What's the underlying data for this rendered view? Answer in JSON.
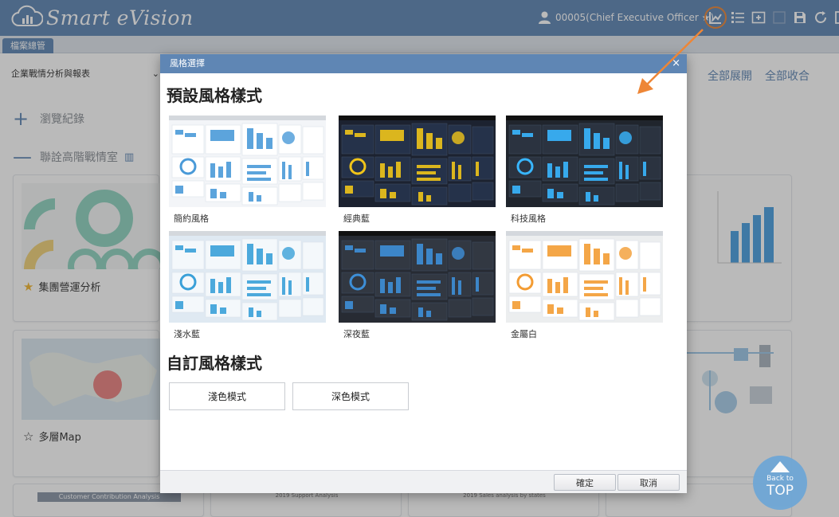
{
  "app": {
    "logo_text": "Smart eVision",
    "user_label": "00005(Chief Executive Officer ★)"
  },
  "toolbar_icons": [
    "style-chart-icon",
    "list-icon",
    "add-folder-icon",
    "blank-icon",
    "save-icon",
    "refresh-icon",
    "logout-icon"
  ],
  "tabs": [
    {
      "label": "檔案總管"
    }
  ],
  "background": {
    "select_value": "企業戰情分析與報表",
    "expand_all": "全部展開",
    "collapse_all": "全部收合",
    "section_history": "瀏覽紀錄",
    "section_room": "聯詮高階戰情室",
    "cards": [
      {
        "title": "集團營運分析",
        "starred": true
      },
      {
        "title": "多層Map",
        "starred": false
      }
    ],
    "bottom_thumb_titles": [
      "Customer Contribution Analysis",
      "2019 Support Analysis",
      "2019 Sales analysis by states"
    ]
  },
  "dialog": {
    "title": "風格選擇",
    "close_label": "×",
    "preset_section": "預設風格樣式",
    "presets": [
      {
        "label": "簡約風格",
        "bg": "#f3f5f8",
        "panel": "#ffffff",
        "accent": "#4a9ad8",
        "dark": false
      },
      {
        "label": "經典藍",
        "bg": "#1c2230",
        "panel": "#25324a",
        "accent": "#f0c419",
        "dark": true
      },
      {
        "label": "科技風格",
        "bg": "#20252d",
        "panel": "#2b3340",
        "accent": "#38b6ff",
        "dark": true
      },
      {
        "label": "淺水藍",
        "bg": "#dfe9f2",
        "panel": "#f4f8fb",
        "accent": "#3aa0d8",
        "dark": false
      },
      {
        "label": "深夜藍",
        "bg": "#272b33",
        "panel": "#323842",
        "accent": "#3d8fd8",
        "dark": true
      },
      {
        "label": "金屬白",
        "bg": "#eceeef",
        "panel": "#ffffff",
        "accent": "#f39c33",
        "dark": false
      }
    ],
    "custom_section": "自訂風格樣式",
    "custom_buttons": [
      {
        "label": "淺色模式"
      },
      {
        "label": "深色模式"
      }
    ],
    "ok_label": "確定",
    "cancel_label": "取消"
  },
  "back_to_top": {
    "small": "Back to",
    "big": "TOP"
  },
  "colors": {
    "header": "#5f86b4",
    "accent_orange": "#ee8636"
  }
}
